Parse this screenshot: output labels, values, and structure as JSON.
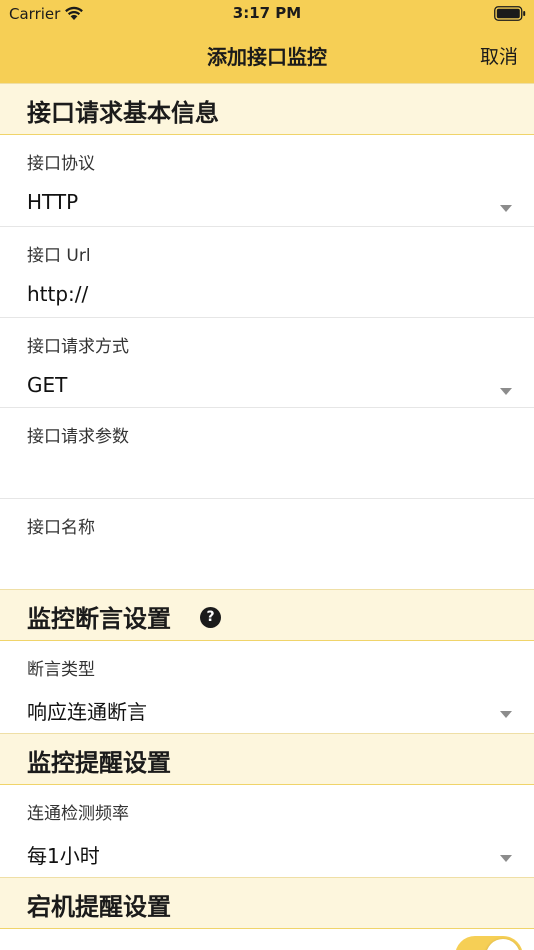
{
  "status_bar": {
    "carrier": "Carrier",
    "time": "3:17 PM"
  },
  "nav": {
    "title": "添加接口监控",
    "cancel_label": "取消"
  },
  "sections": {
    "basic": "接口请求基本信息",
    "assert": "监控断言设置",
    "reminder": "监控提醒设置",
    "downtime": "宕机提醒设置"
  },
  "fields": {
    "protocol": {
      "label": "接口协议",
      "value": "HTTP"
    },
    "url": {
      "label": "接口 Url",
      "value": "http://"
    },
    "method": {
      "label": "接口请求方式",
      "value": "GET"
    },
    "params": {
      "label": "接口请求参数",
      "value": ""
    },
    "name": {
      "label": "接口名称",
      "value": ""
    },
    "assert_type": {
      "label": "断言类型",
      "value": "响应连通断言"
    },
    "frequency": {
      "label": "连通检测频率",
      "value": "每1小时"
    }
  },
  "help_glyph": "?",
  "colors": {
    "accent": "#f6cf55",
    "section_bg": "#fdf6dd"
  }
}
